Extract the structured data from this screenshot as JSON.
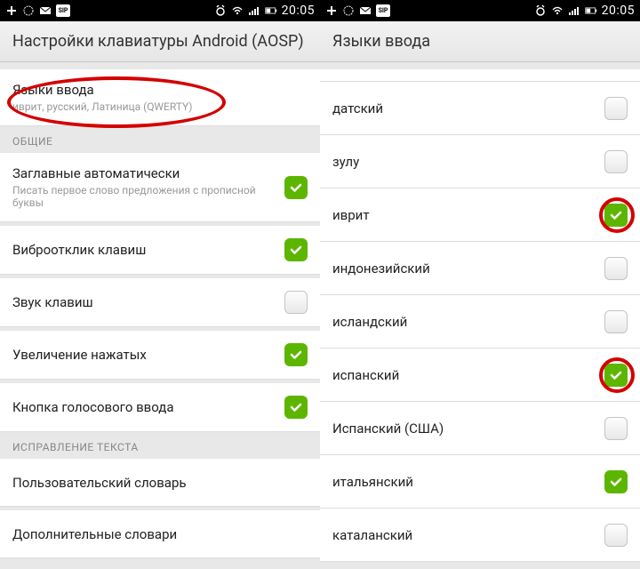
{
  "status": {
    "time": "20:05"
  },
  "left": {
    "header": "Настройки клавиатуры Android (AOSP)",
    "lang_row": {
      "title": "Языки ввода",
      "sub": "иврит, русский, Латиница (QWERTY)"
    },
    "section_general": "ОБЩИЕ",
    "rows": [
      {
        "title": "Заглавные автоматически",
        "sub": "Писать первое слово предложения с прописной буквы",
        "on": true
      },
      {
        "title": "Виброотклик клавиш",
        "on": true
      },
      {
        "title": "Звук клавиш",
        "on": false
      },
      {
        "title": "Увеличение нажатых",
        "on": true
      },
      {
        "title": "Кнопка голосового ввода",
        "on": true
      }
    ],
    "section_correction": "ИСПРАВЛЕНИЕ ТЕКСТА",
    "dict_rows": [
      {
        "title": "Пользовательский словарь"
      },
      {
        "title": "Дополнительные словари"
      }
    ]
  },
  "right": {
    "header": "Языки ввода",
    "langs": [
      {
        "title": "датский",
        "on": false
      },
      {
        "title": "зулу",
        "on": false
      },
      {
        "title": "иврит",
        "on": true,
        "annot": true
      },
      {
        "title": "индонезийский",
        "on": false
      },
      {
        "title": "исландский",
        "on": false
      },
      {
        "title": "испанский",
        "on": true,
        "annot": true
      },
      {
        "title": "Испанский (США)",
        "on": false
      },
      {
        "title": "итальянский",
        "on": true
      },
      {
        "title": "каталанский",
        "on": false
      }
    ]
  }
}
